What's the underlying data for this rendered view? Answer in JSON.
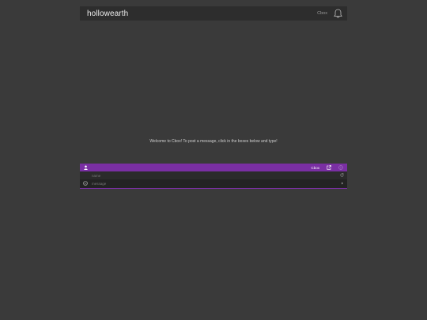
{
  "header": {
    "title": "hollowearth",
    "link_label": "Cbox",
    "bell_icon": "bell-icon"
  },
  "welcome_message": "Welcome to Cbox! To post a message, click in the boxes below and type!",
  "chat": {
    "bar_color": "#7a2fa3",
    "user_icon": "user-icon",
    "cbox_link": "Cbox",
    "popout_icon": "popout-icon",
    "info_icon": "info-icon",
    "name_placeholder": "name",
    "message_placeholder": "message",
    "smile_icon": "smile-icon",
    "refresh_icon": "refresh-icon",
    "send_icon": "send-icon"
  }
}
